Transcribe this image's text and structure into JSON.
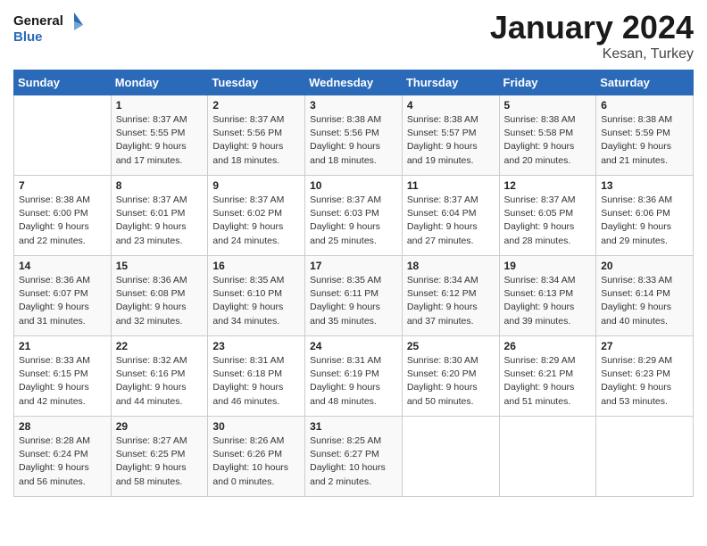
{
  "header": {
    "logo_line1": "General",
    "logo_line2": "Blue",
    "month": "January 2024",
    "location": "Kesan, Turkey"
  },
  "days_of_week": [
    "Sunday",
    "Monday",
    "Tuesday",
    "Wednesday",
    "Thursday",
    "Friday",
    "Saturday"
  ],
  "weeks": [
    [
      {
        "num": "",
        "info": ""
      },
      {
        "num": "1",
        "info": "Sunrise: 8:37 AM\nSunset: 5:55 PM\nDaylight: 9 hours\nand 17 minutes."
      },
      {
        "num": "2",
        "info": "Sunrise: 8:37 AM\nSunset: 5:56 PM\nDaylight: 9 hours\nand 18 minutes."
      },
      {
        "num": "3",
        "info": "Sunrise: 8:38 AM\nSunset: 5:56 PM\nDaylight: 9 hours\nand 18 minutes."
      },
      {
        "num": "4",
        "info": "Sunrise: 8:38 AM\nSunset: 5:57 PM\nDaylight: 9 hours\nand 19 minutes."
      },
      {
        "num": "5",
        "info": "Sunrise: 8:38 AM\nSunset: 5:58 PM\nDaylight: 9 hours\nand 20 minutes."
      },
      {
        "num": "6",
        "info": "Sunrise: 8:38 AM\nSunset: 5:59 PM\nDaylight: 9 hours\nand 21 minutes."
      }
    ],
    [
      {
        "num": "7",
        "info": "Sunrise: 8:38 AM\nSunset: 6:00 PM\nDaylight: 9 hours\nand 22 minutes."
      },
      {
        "num": "8",
        "info": "Sunrise: 8:37 AM\nSunset: 6:01 PM\nDaylight: 9 hours\nand 23 minutes."
      },
      {
        "num": "9",
        "info": "Sunrise: 8:37 AM\nSunset: 6:02 PM\nDaylight: 9 hours\nand 24 minutes."
      },
      {
        "num": "10",
        "info": "Sunrise: 8:37 AM\nSunset: 6:03 PM\nDaylight: 9 hours\nand 25 minutes."
      },
      {
        "num": "11",
        "info": "Sunrise: 8:37 AM\nSunset: 6:04 PM\nDaylight: 9 hours\nand 27 minutes."
      },
      {
        "num": "12",
        "info": "Sunrise: 8:37 AM\nSunset: 6:05 PM\nDaylight: 9 hours\nand 28 minutes."
      },
      {
        "num": "13",
        "info": "Sunrise: 8:36 AM\nSunset: 6:06 PM\nDaylight: 9 hours\nand 29 minutes."
      }
    ],
    [
      {
        "num": "14",
        "info": "Sunrise: 8:36 AM\nSunset: 6:07 PM\nDaylight: 9 hours\nand 31 minutes."
      },
      {
        "num": "15",
        "info": "Sunrise: 8:36 AM\nSunset: 6:08 PM\nDaylight: 9 hours\nand 32 minutes."
      },
      {
        "num": "16",
        "info": "Sunrise: 8:35 AM\nSunset: 6:10 PM\nDaylight: 9 hours\nand 34 minutes."
      },
      {
        "num": "17",
        "info": "Sunrise: 8:35 AM\nSunset: 6:11 PM\nDaylight: 9 hours\nand 35 minutes."
      },
      {
        "num": "18",
        "info": "Sunrise: 8:34 AM\nSunset: 6:12 PM\nDaylight: 9 hours\nand 37 minutes."
      },
      {
        "num": "19",
        "info": "Sunrise: 8:34 AM\nSunset: 6:13 PM\nDaylight: 9 hours\nand 39 minutes."
      },
      {
        "num": "20",
        "info": "Sunrise: 8:33 AM\nSunset: 6:14 PM\nDaylight: 9 hours\nand 40 minutes."
      }
    ],
    [
      {
        "num": "21",
        "info": "Sunrise: 8:33 AM\nSunset: 6:15 PM\nDaylight: 9 hours\nand 42 minutes."
      },
      {
        "num": "22",
        "info": "Sunrise: 8:32 AM\nSunset: 6:16 PM\nDaylight: 9 hours\nand 44 minutes."
      },
      {
        "num": "23",
        "info": "Sunrise: 8:31 AM\nSunset: 6:18 PM\nDaylight: 9 hours\nand 46 minutes."
      },
      {
        "num": "24",
        "info": "Sunrise: 8:31 AM\nSunset: 6:19 PM\nDaylight: 9 hours\nand 48 minutes."
      },
      {
        "num": "25",
        "info": "Sunrise: 8:30 AM\nSunset: 6:20 PM\nDaylight: 9 hours\nand 50 minutes."
      },
      {
        "num": "26",
        "info": "Sunrise: 8:29 AM\nSunset: 6:21 PM\nDaylight: 9 hours\nand 51 minutes."
      },
      {
        "num": "27",
        "info": "Sunrise: 8:29 AM\nSunset: 6:23 PM\nDaylight: 9 hours\nand 53 minutes."
      }
    ],
    [
      {
        "num": "28",
        "info": "Sunrise: 8:28 AM\nSunset: 6:24 PM\nDaylight: 9 hours\nand 56 minutes."
      },
      {
        "num": "29",
        "info": "Sunrise: 8:27 AM\nSunset: 6:25 PM\nDaylight: 9 hours\nand 58 minutes."
      },
      {
        "num": "30",
        "info": "Sunrise: 8:26 AM\nSunset: 6:26 PM\nDaylight: 10 hours\nand 0 minutes."
      },
      {
        "num": "31",
        "info": "Sunrise: 8:25 AM\nSunset: 6:27 PM\nDaylight: 10 hours\nand 2 minutes."
      },
      {
        "num": "",
        "info": ""
      },
      {
        "num": "",
        "info": ""
      },
      {
        "num": "",
        "info": ""
      }
    ]
  ]
}
